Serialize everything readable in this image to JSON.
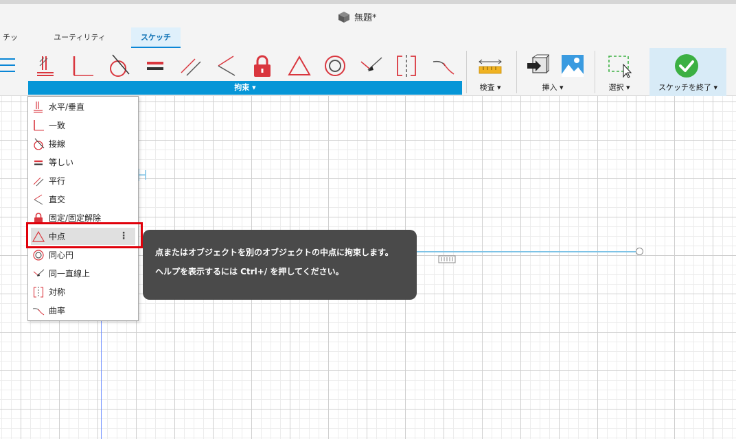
{
  "window": {
    "title": "無題*"
  },
  "tabs": [
    "チック",
    "ユーティリティ",
    "スケッチ"
  ],
  "active_tab": "スケッチ",
  "ribbon": {
    "groups": {
      "constraints": "拘束 ▾",
      "inspect": "検査 ▾",
      "insert": "挿入 ▾",
      "select": "選択 ▾",
      "finish": "スケッチを終了 ▾"
    }
  },
  "menu": {
    "items": [
      {
        "icon": "horizontal-vertical-icon",
        "label": "水平/垂直"
      },
      {
        "icon": "coincident-icon",
        "label": "一致"
      },
      {
        "icon": "tangent-icon",
        "label": "接線"
      },
      {
        "icon": "equal-icon",
        "label": "等しい"
      },
      {
        "icon": "parallel-icon",
        "label": "平行"
      },
      {
        "icon": "perpendicular-icon",
        "label": "直交"
      },
      {
        "icon": "lock-icon",
        "label": "固定/固定解除"
      },
      {
        "icon": "midpoint-icon",
        "label": "中点"
      },
      {
        "icon": "concentric-icon",
        "label": "同心円"
      },
      {
        "icon": "collinear-icon",
        "label": "同一直線上"
      },
      {
        "icon": "symmetry-icon",
        "label": "対称"
      },
      {
        "icon": "curvature-icon",
        "label": "曲率"
      }
    ],
    "highlighted": "中点",
    "more_glyph": "⋮"
  },
  "tooltip": {
    "line1": "点またはオブジェクトを別のオブジェクトの中点に拘束します。",
    "line2": "ヘルプを表示するには Ctrl+/ を押してください。"
  },
  "colors": {
    "accent": "#0696d7",
    "constraint_red": "#d9363e",
    "finish_green": "#3cb043",
    "highlight_box": "#e0000a",
    "tooltip_bg": "#4a4a4a"
  }
}
